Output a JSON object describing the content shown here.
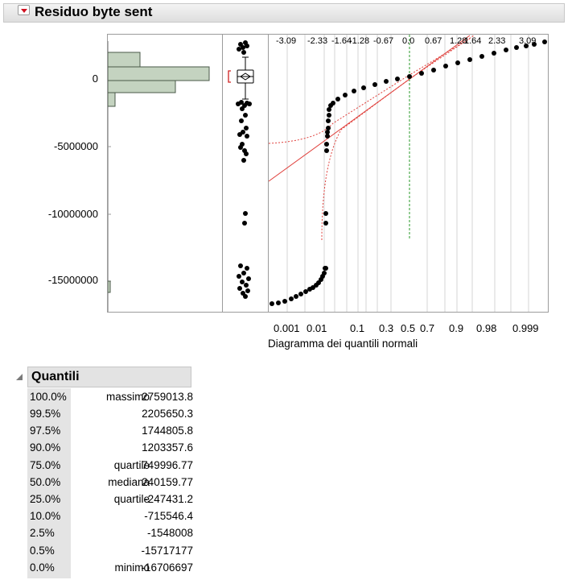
{
  "report": {
    "title": "Residuo byte sent"
  },
  "distribution": {
    "y_axis_ticks": [
      "0",
      "-5000000",
      "-10000000",
      "-15000000"
    ],
    "qq_top_ticks": [
      "-3.09",
      "-2.33",
      "-1.64",
      "-1.28",
      "-0.67",
      "0.0",
      "0.67",
      "1.28",
      "1.64",
      "2.33",
      "3.09"
    ],
    "qq_bottom_ticks": [
      "0.001",
      "0.01",
      "0.1",
      "0.3",
      "0.5",
      "0.7",
      "0.9",
      "0.98",
      "0.999"
    ],
    "qq_xlabel": "Diagramma dei quantili normali",
    "histogram_bins": [
      {
        "range": "1000000 to 2000000",
        "relative_count": 0.35
      },
      {
        "range": "0 to 1000000",
        "relative_count": 0.9
      },
      {
        "range": "-1000000 to 0",
        "relative_count": 0.6
      },
      {
        "range": "-2000000 to -1000000",
        "relative_count": 0.06
      },
      {
        "range": "-16000000 to -15000000",
        "relative_count": 0.01
      }
    ],
    "colors": {
      "histogram": "#c4d3c0",
      "points": "#000000",
      "reference_line": "#e0403c",
      "median_line": "#2a9a2a"
    }
  },
  "quantiles": {
    "title": "Quantili",
    "rows": [
      {
        "pct": "100.0%",
        "label": "massimo",
        "value": "2759013.8"
      },
      {
        "pct": "99.5%",
        "label": "",
        "value": "2205650.3"
      },
      {
        "pct": "97.5%",
        "label": "",
        "value": "1744805.8"
      },
      {
        "pct": "90.0%",
        "label": "",
        "value": "1203357.6"
      },
      {
        "pct": "75.0%",
        "label": "quartile",
        "value": "749996.77"
      },
      {
        "pct": "50.0%",
        "label": "mediana",
        "value": "240159.77"
      },
      {
        "pct": "25.0%",
        "label": "quartile",
        "value": "-247431.2"
      },
      {
        "pct": "10.0%",
        "label": "",
        "value": "-715546.4"
      },
      {
        "pct": "2.5%",
        "label": "",
        "value": "-1548008"
      },
      {
        "pct": "0.5%",
        "label": "",
        "value": "-15717177"
      },
      {
        "pct": "0.0%",
        "label": "minimo",
        "value": "-16706697"
      }
    ]
  }
}
